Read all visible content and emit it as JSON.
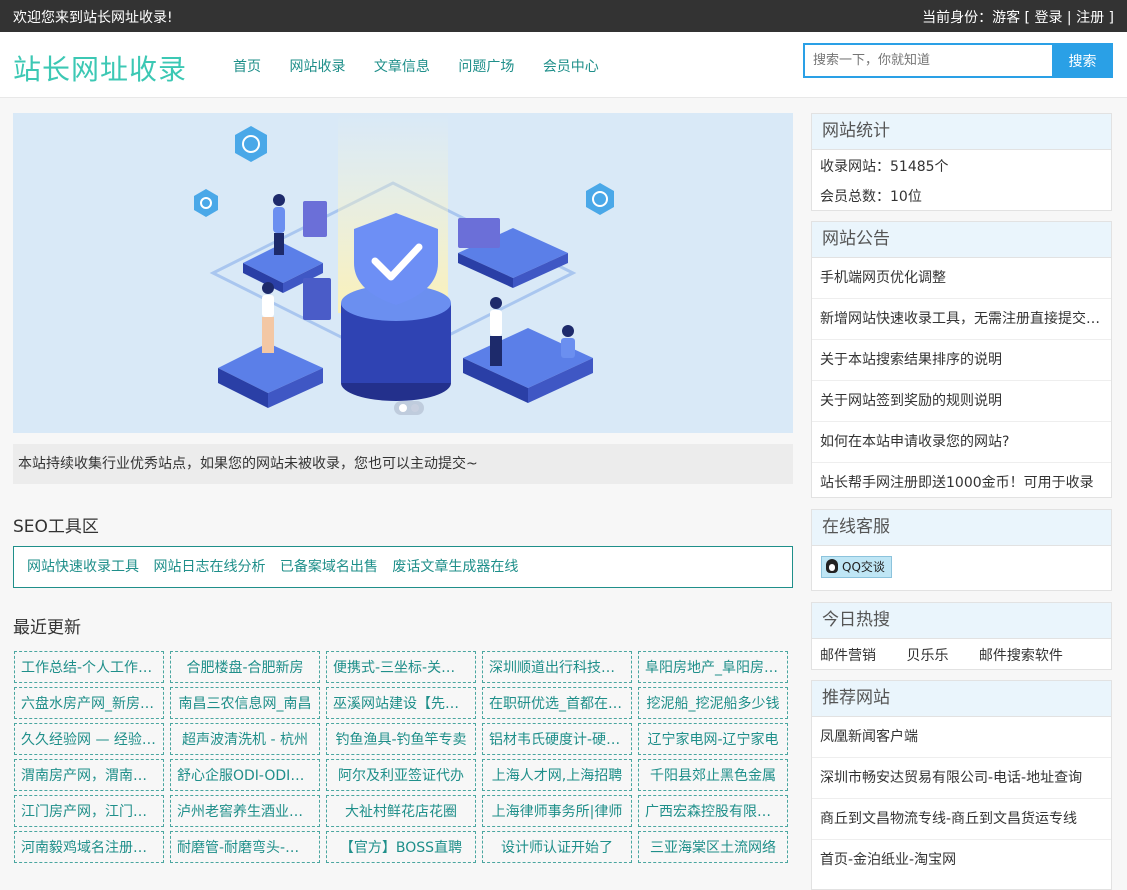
{
  "topbar": {
    "welcome": "欢迎您来到站长网址收录!",
    "identity_prefix": "当前身份：游客 [ ",
    "login": "登录",
    "sep": " | ",
    "register": "注册",
    "identity_suffix": " ]"
  },
  "header": {
    "logo": "站长网址收录",
    "nav": [
      "首页",
      "网站收录",
      "文章信息",
      "问题广场",
      "会员中心"
    ],
    "search": {
      "placeholder": "搜索一下，你就知道",
      "button": "搜索"
    }
  },
  "notice": "本站持续收集行业优秀站点，如果您的网站未被收录，您也可以主动提交~",
  "seo": {
    "title": "SEO工具区",
    "tools": [
      "网站快速收录工具",
      "网站日志在线分析",
      "已备案域名出售",
      "废话文章生成器在线"
    ]
  },
  "recent": {
    "title": "最近更新",
    "items": [
      "工作总结-个人工作总结",
      "合肥楼盘-合肥新房",
      "便携式-三坐标-关节臂",
      "深圳顺道出行科技有限公司",
      "阜阳房地产_阜阳房产网",
      "六盘水房产网_新房二手房",
      "南昌三农信息网_南昌",
      "巫溪网站建设【先锋网络】",
      "在职研优选_首都在职研",
      "挖泥船_挖泥船多少钱",
      "久久经验网 — 经验分享",
      "超声波清洗机 - 杭州",
      "钓鱼渔具-钓鱼竿专卖",
      "铝材韦氏硬度计-硬度计",
      "辽宁家电网-辽宁家电",
      "渭南房产网，渭南房产",
      "舒心企服ODI-ODI备案",
      "阿尔及利亚签证代办",
      "上海人才网,上海招聘",
      "千阳县郊止黑色金属",
      "江门房产网，江门房产",
      "泸州老窖养生酒业有限",
      "大祉村鲜花店花圈",
      "上海律师事务所|律师",
      "广西宏森控股有限公司",
      "河南毅鸡域名注册服务",
      "耐磨管-耐磨弯头-厂家",
      "【官方】BOSS直聘",
      "设计师认证开始了",
      "三亚海棠区土流网络"
    ]
  },
  "stats": {
    "title": "网站统计",
    "sites": "收录网站：51485个",
    "members": "会员总数：10位"
  },
  "announcements": {
    "title": "网站公告",
    "items": [
      "手机端网页优化调整",
      "新增网站快速收录工具，无需注册直接提交网站",
      "关于本站搜索结果排序的说明",
      "关于网站签到奖励的规则说明",
      "如何在本站申请收录您的网站?",
      "站长帮手网注册即送1000金币！可用于收录"
    ]
  },
  "service": {
    "title": "在线客服",
    "qq": "QQ交谈"
  },
  "hot": {
    "title": "今日热搜",
    "items": [
      "邮件营销",
      "贝乐乐",
      "邮件搜索软件"
    ]
  },
  "recommend": {
    "title": "推荐网站",
    "items": [
      "凤凰新闻客户端",
      "深圳市畅安达贸易有限公司-电话-地址查询",
      "商丘到文昌物流专线-商丘到文昌货运专线",
      "首页-金泊纸业-淘宝网"
    ]
  },
  "colors": {
    "accent": "#1f8f8a",
    "logo": "#3cc8b4",
    "search_blue": "#2aa0e6",
    "topbar": "#333333"
  }
}
